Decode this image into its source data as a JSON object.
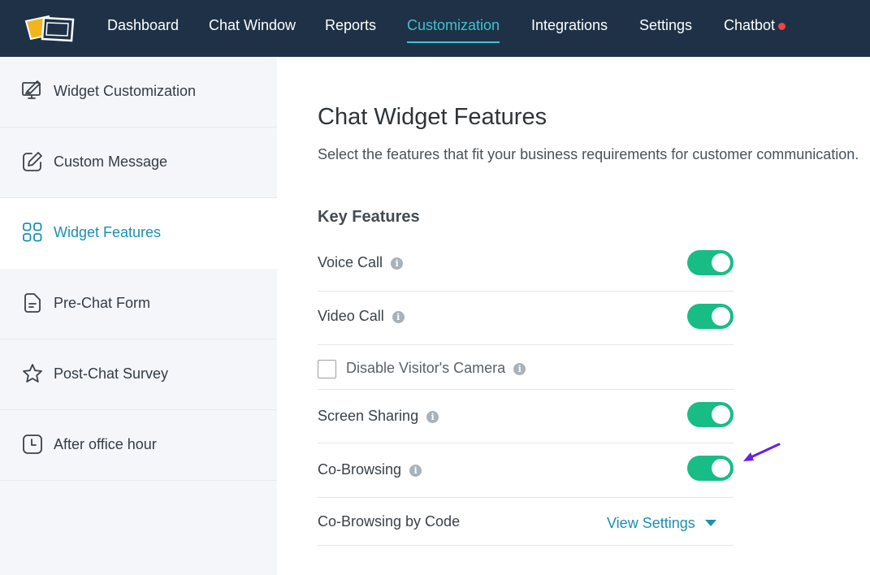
{
  "nav": {
    "items": [
      {
        "label": "Dashboard"
      },
      {
        "label": "Chat Window"
      },
      {
        "label": "Reports"
      },
      {
        "label": "Customization"
      },
      {
        "label": "Integrations"
      },
      {
        "label": "Settings"
      },
      {
        "label": "Chatbot"
      }
    ],
    "active": "Customization",
    "notification_color": "#ef4444"
  },
  "sidebar": {
    "items": [
      {
        "label": "Widget Customization",
        "icon": "monitor-brush-icon"
      },
      {
        "label": "Custom Message",
        "icon": "edit-icon"
      },
      {
        "label": "Widget Features",
        "icon": "grid-icon"
      },
      {
        "label": "Pre-Chat Form",
        "icon": "document-icon"
      },
      {
        "label": "Post-Chat Survey",
        "icon": "star-icon"
      },
      {
        "label": "After office hour",
        "icon": "clock-icon"
      }
    ],
    "active": "Widget Features"
  },
  "main": {
    "title": "Chat Widget Features",
    "subtitle": "Select the features that fit your business requirements for customer communication.",
    "section_title": "Key Features",
    "features": {
      "voice_call": {
        "label": "Voice Call",
        "enabled": true
      },
      "video_call": {
        "label": "Video Call",
        "enabled": true
      },
      "disable_camera": {
        "label": "Disable Visitor's Camera",
        "checked": false
      },
      "screen_sharing": {
        "label": "Screen Sharing",
        "enabled": true
      },
      "co_browsing": {
        "label": "Co-Browsing",
        "enabled": true
      },
      "co_browsing_code": {
        "label": "Co-Browsing by Code",
        "action": "View Settings"
      }
    }
  },
  "colors": {
    "topbar": "#1e3146",
    "accent": "#1a8fb0",
    "nav_active": "#3fc1d3",
    "toggle_on": "#17bd84",
    "annotation_arrow": "#6a1fe6"
  }
}
